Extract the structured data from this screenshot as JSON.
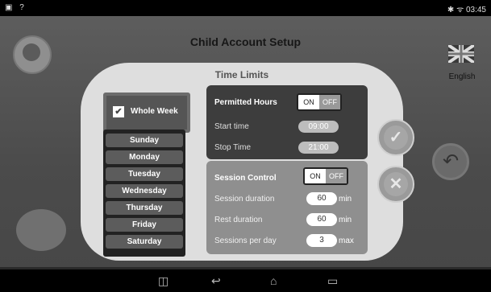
{
  "statusbar": {
    "left_icons": "▣ ?",
    "right": "✱ ᯤ 03:45"
  },
  "app": {
    "title": "Child Account Setup",
    "language": "English"
  },
  "dialog": {
    "title": "Time Limits",
    "whole_week": "Whole Week",
    "days": [
      "Sunday",
      "Monday",
      "Tuesday",
      "Wednesday",
      "Thursday",
      "Friday",
      "Saturday"
    ],
    "permitted": {
      "label": "Permitted Hours",
      "on": "ON",
      "off": "OFF",
      "start_label": "Start time",
      "start_value": "09:00",
      "stop_label": "Stop Time",
      "stop_value": "21:00"
    },
    "session": {
      "label": "Session Control",
      "on": "ON",
      "off": "OFF",
      "duration_label": "Session duration",
      "duration_value": "60",
      "duration_unit": "min",
      "rest_label": "Rest duration",
      "rest_value": "60",
      "rest_unit": "min",
      "per_day_label": "Sessions per day",
      "per_day_value": "3",
      "per_day_unit": "max"
    }
  },
  "colors": {
    "accent": "#3d3d3d",
    "dialog_bg": "#dedede"
  }
}
